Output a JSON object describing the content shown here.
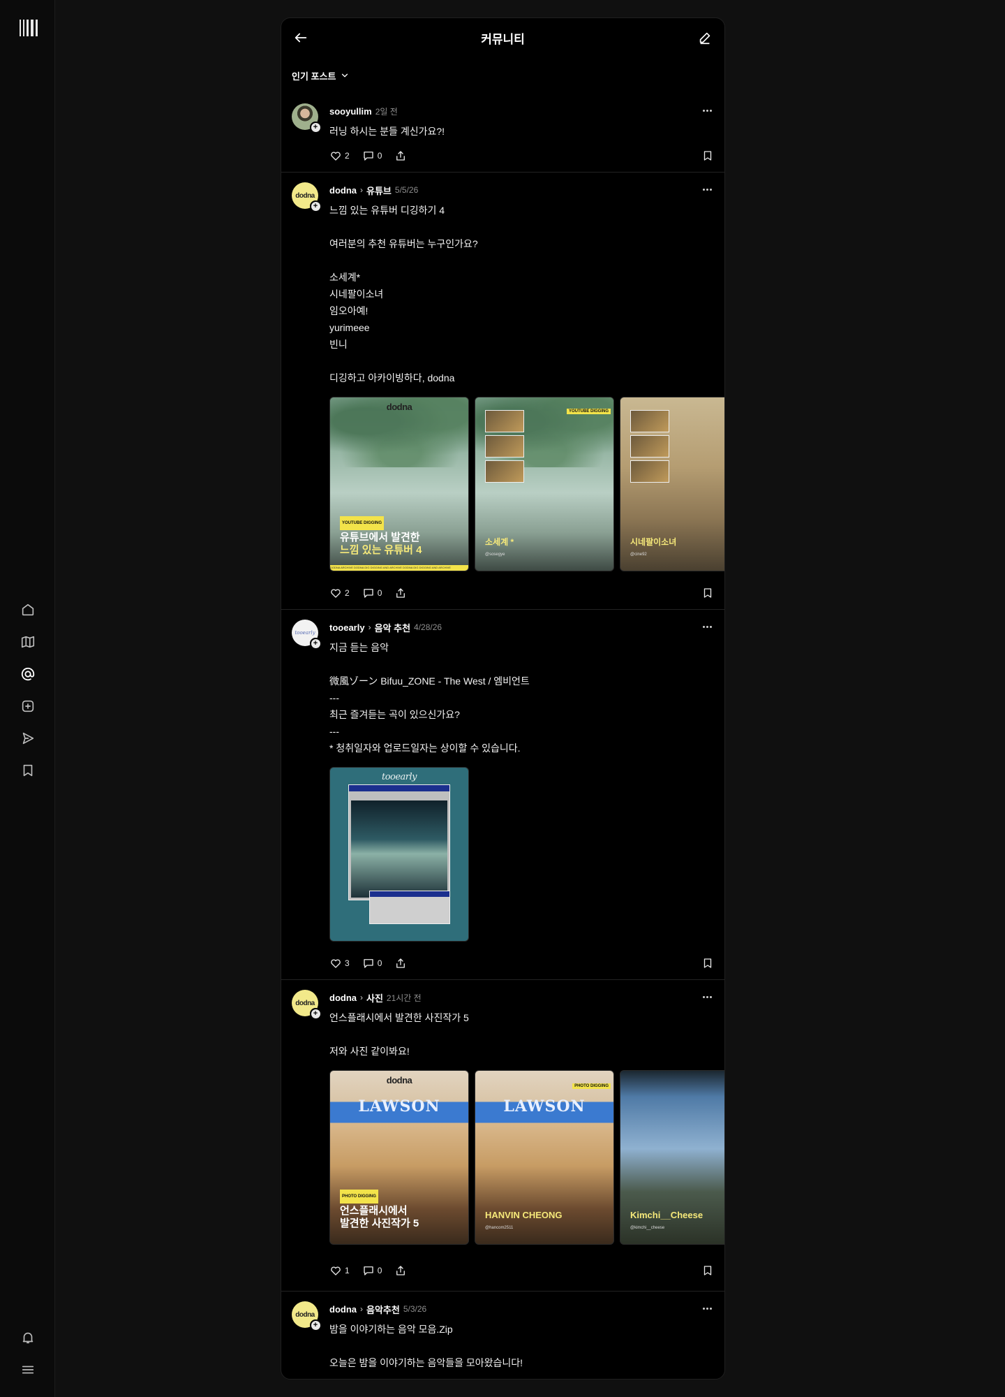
{
  "app": {
    "title": "커뮤니티"
  },
  "rail": {
    "icons": [
      "home-icon",
      "map-icon",
      "at-icon",
      "plus-square-icon",
      "send-icon",
      "bookmark-icon",
      "bell-icon",
      "menu-icon"
    ]
  },
  "filter": {
    "label": "인기 포스트"
  },
  "posts": [
    {
      "user": "sooyullim",
      "category": "",
      "time": "2일 전",
      "text": "러닝 하시는 분들 계신가요?!",
      "likes": "2",
      "comments": "0"
    },
    {
      "user": "dodna",
      "avatar_text": "dodna",
      "category": "유튜브",
      "time": "5/5/26",
      "text": "느낌 있는 유튜버 디깅하기 4\n\n여러분의 추천 유튜버는 누구인가요?\n\n소세계*\n시네팔이소녀\n임오아예!\nyurimeee\n빈니\n\n디깅하고 아카이빙하다, dodna",
      "images": [
        {
          "brand": "dodna",
          "tag": "YOUTUBE DIGGING",
          "caption1": "유튜브에서 발견한",
          "caption2": "느낌 있는 유튜버 4",
          "strip": "DODNA ARCHIVE  DODNA DIG DIGGING AND ARCHIVE  DODNA DIG DIGGING AND ARCHIVE"
        },
        {
          "tag": "YOUTUBE DIGGING",
          "caption1": "소세계 *",
          "sub": "@sosegye"
        },
        {
          "tag": "YO",
          "caption1": "시네팔이소녀",
          "sub": "@cine92"
        }
      ],
      "likes": "2",
      "comments": "0"
    },
    {
      "user": "tooearly",
      "avatar_text": "tooearly",
      "category": "음악 추천",
      "time": "4/28/26",
      "text": "지금 듣는 음악\n\n 微風ゾーン Bifuu_ZONE - The West / 엠비언트\n---\n최근 즐겨듣는 곡이 있으신가요?\n---\n* 청취일자와 업로드일자는 상이할 수 있습니다.",
      "images": [
        {
          "brand": "tooearly"
        }
      ],
      "likes": "3",
      "comments": "0"
    },
    {
      "user": "dodna",
      "avatar_text": "dodna",
      "category": "사진",
      "time": "21시간 전",
      "text": "언스플래시에서 발견한 사진작가 5\n\n저와 사진 같이봐요!",
      "images": [
        {
          "brand": "dodna",
          "sign": "LAWSON",
          "tag": "PHOTO DIGGING",
          "caption1": "언스플래시에서",
          "caption2": "발견한 사진작가 5"
        },
        {
          "sign": "LAWSON",
          "tag": "PHOTO DIGGING",
          "caption1": "HANVIN CHEONG",
          "sub": "@hancom2511"
        },
        {
          "caption1": "Kimchi__Cheese",
          "sub": "@kimchi__cheese"
        }
      ],
      "likes": "1",
      "comments": "0"
    },
    {
      "user": "dodna",
      "avatar_text": "dodna",
      "category": "음악추천",
      "time": "5/3/26",
      "text": "밤을 이야기하는 음악 모음.Zip\n\n오늘은 밤을 이야기하는 음악들을 모아왔습니다!"
    }
  ]
}
